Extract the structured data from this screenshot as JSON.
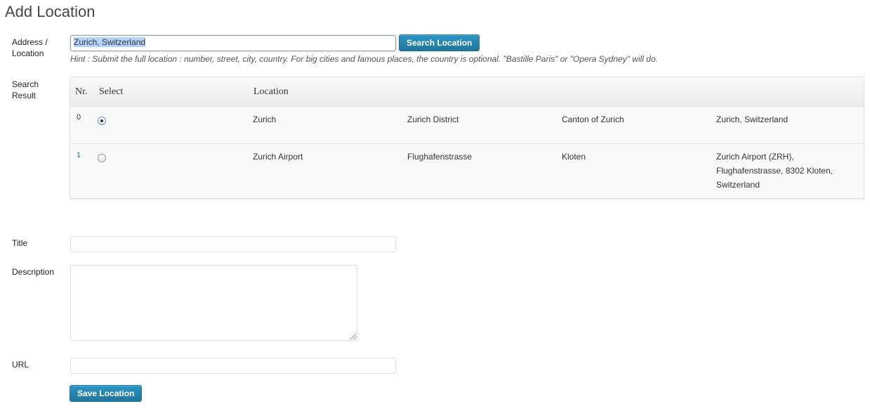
{
  "page": {
    "title": "Add Location"
  },
  "address": {
    "label_line1": "Address /",
    "label_line2": "Location",
    "value": "Zurich, Switzerland",
    "search_button": "Search Location",
    "hint": "Hint : Submit the full location : number, street, city, country. For big cities and famous places, the country is optional. \"Bastille Paris\" or \"Opera Sydney\" will do."
  },
  "search_result": {
    "label_line1": "Search",
    "label_line2": "Result",
    "headers": {
      "nr": "Nr.",
      "select": "Select",
      "location": "Location"
    },
    "rows": [
      {
        "nr": "0",
        "selected": true,
        "col1": "Zurich",
        "col2": "Zurich District",
        "col3": "Canton of Zurich",
        "col4_lines": [
          "Zurich, Switzerland"
        ]
      },
      {
        "nr": "1",
        "selected": false,
        "col1": "Zurich Airport",
        "col2": "Flughafenstrasse",
        "col3": "Kloten",
        "col4_lines": [
          "Zurich Airport (ZRH),",
          "Flughafenstrasse, 8302 Kloten,",
          "Switzerland"
        ]
      }
    ]
  },
  "form": {
    "title_label": "Title",
    "title_value": "",
    "description_label": "Description",
    "description_value": "",
    "url_label": "URL",
    "url_value": "",
    "save_button": "Save Location"
  },
  "colors": {
    "primary_button": "#21759b",
    "selection": "#b3d4fd"
  }
}
